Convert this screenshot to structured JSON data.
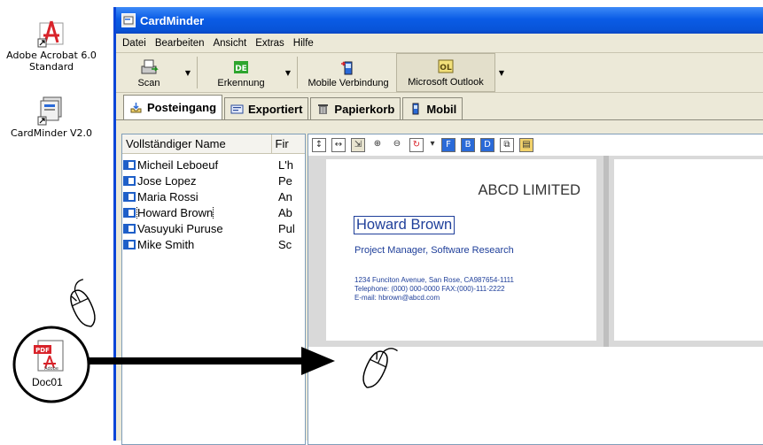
{
  "desktop": {
    "icons": [
      {
        "name": "acrobat",
        "label_line1": "Adobe Acrobat 6.0",
        "label_line2": "Standard"
      },
      {
        "name": "cardminder",
        "label_line1": "CardMinder V2.0"
      }
    ],
    "dragged_file": {
      "label": "Doc01",
      "badge": "PDF",
      "brand": "Adobe"
    }
  },
  "window": {
    "title": "CardMinder",
    "menu": [
      "Datei",
      "Bearbeiten",
      "Ansicht",
      "Extras",
      "Hilfe"
    ],
    "toolbar": {
      "scan": "Scan",
      "recognition": "Erkennung",
      "recognition_badge": "DE",
      "mobile": "Mobile Verbindung",
      "outlook": "Microsoft Outlook",
      "outlook_badge": "OL"
    },
    "tabs": [
      "Posteingang",
      "Exportiert",
      "Papierkorb",
      "Mobil"
    ],
    "list": {
      "headers": [
        "Vollständiger Name",
        "Fir"
      ],
      "rows": [
        {
          "name": "Micheil Leboeuf",
          "first": "L'h"
        },
        {
          "name": "Jose Lopez",
          "first": "Pe"
        },
        {
          "name": "Maria Rossi",
          "first": "An"
        },
        {
          "name": "Howard Brown",
          "first": "Ab"
        },
        {
          "name": "Vasuyuki Puruse",
          "first": "Pul"
        },
        {
          "name": "Mike Smith",
          "first": "Sc"
        }
      ],
      "selected_index": 3
    },
    "card": {
      "company": "ABCD LIMITED",
      "person": "Howard Brown",
      "title": "Project Manager, Software Research",
      "address": "1234 Funciton Avenue, San Rose, CA987654-1111",
      "phone": "Telephone: (000) 000-0000  FAX:(000)-111-2222",
      "email": "E-mail: hbrown@abcd.com"
    }
  },
  "colors": {
    "title_bar": "#0a5ce6",
    "card_text": "#1f3f9a",
    "card_icon": "#1e5fc8",
    "acrobat_red": "#d8232a"
  }
}
